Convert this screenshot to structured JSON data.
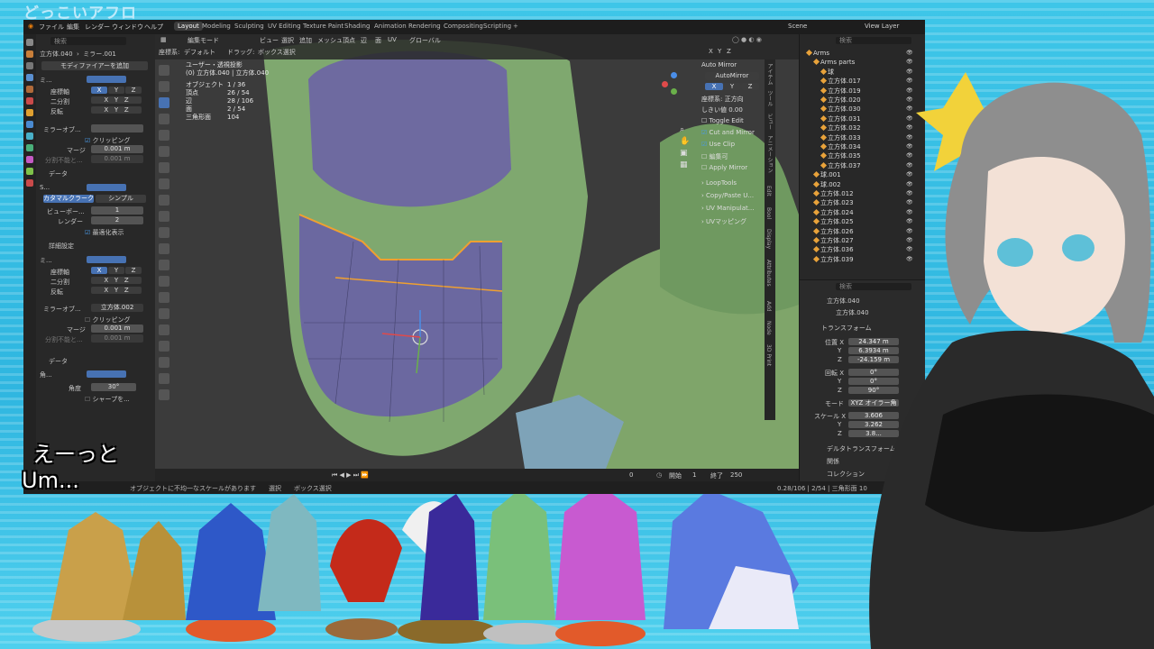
{
  "channel_logo": "どっこいアフロ",
  "topbar": {
    "menus": [
      "ファイル",
      "編集",
      "レンダー",
      "ウィンドウ",
      "ヘルプ"
    ],
    "workspaces": [
      "Layout",
      "Modeling",
      "Sculpting",
      "UV Editing",
      "Texture Paint",
      "Shading",
      "Animation",
      "Rendering",
      "Compositing",
      "Scripting"
    ],
    "active_workspace": "Layout",
    "scene_label": "Scene",
    "view_layer_label": "View Layer"
  },
  "left_panel": {
    "object_name": "立方体.040",
    "modifier_name": "ミラー.001",
    "add_modifier": "モディファイアーを追加",
    "mirror1": {
      "name": "ミ...",
      "axis_label": "座標軸",
      "bisect_label": "二分割",
      "flip_label": "反転",
      "x": "X",
      "y": "Y",
      "z": "Z",
      "mirror_obj_label": "ミラーオブ...",
      "clipping": "クリッピング",
      "merge_label": "マージ",
      "merge_value": "0.001 m",
      "bisect_dist_label": "分割不能と...",
      "bisect_dist_value": "0.001 m",
      "data_label": "データ"
    },
    "subsurf": {
      "name": "S...",
      "catmull": "カタマルクラーク",
      "simple": "シンプル",
      "viewport_label": "ビューポー...",
      "viewport_value": "1",
      "render_label": "レンダー",
      "render_value": "2",
      "optimal": "最適化表示",
      "advanced": "詳細設定"
    },
    "mirror2": {
      "name": "ミ...",
      "axis_label": "座標軸",
      "bisect_label": "二分割",
      "flip_label": "反転",
      "x": "X",
      "y": "Y",
      "z": "Z",
      "mirror_obj_label": "ミラーオブ...",
      "mirror_obj_value": "立方体.002",
      "clipping": "クリッピング",
      "merge_label": "マージ",
      "merge_value": "0.001 m",
      "bisect_dist_label": "分割不能と...",
      "bisect_dist_value": "0.001 m",
      "data_label": "データ"
    },
    "bevel": {
      "name": "角...",
      "angle_label": "角度",
      "angle_value": "30°",
      "sharp_label": "シャープを..."
    }
  },
  "viewport": {
    "mode": "編集モード",
    "menus": [
      "ビュー",
      "選択",
      "追加",
      "メッシュ",
      "頂点",
      "辺",
      "面",
      "UV"
    ],
    "transform_orientation": "グローバル",
    "coord_label": "座標系:",
    "coord_value": "デフォルト",
    "drag_label": "ドラッグ:",
    "drag_value": "ボックス選択",
    "view_title": "ユーザー・透視投影",
    "view_subtitle": "(0) 立方体.040 | 立方体.040",
    "stats": [
      {
        "label": "オブジェクト",
        "value": "1 / 36"
      },
      {
        "label": "頂点",
        "value": "26 / 54"
      },
      {
        "label": "辺",
        "value": "28 / 106"
      },
      {
        "label": "面",
        "value": "2 / 54"
      },
      {
        "label": "三角形面",
        "value": "104"
      }
    ],
    "axis_x": "X",
    "axis_y": "Y",
    "axis_z": "Z",
    "npanel": {
      "auto_mirror_header": "Auto Mirror",
      "auto_mirror_btn": "AutoMirror",
      "x": "X",
      "y": "Y",
      "z": "Z",
      "axis_label": "座標系:",
      "axis_value": "正方向",
      "threshold_label": "しきい値",
      "threshold_value": "0.00",
      "toggle_edit": "Toggle Edit",
      "cut_mirror": "Cut and Mirror",
      "use_clip": "Use Clip",
      "edit_label": "編集可",
      "apply_mirror": "Apply Mirror",
      "looptools": "LoopTools",
      "copy_paste": "Copy/Paste U...",
      "uv_manip": "UV Manipulat...",
      "uv_mapping": "UVマッピング"
    },
    "side_tabs": [
      "アイテム",
      "ツール",
      "ビュー",
      "アニメーション",
      "Edit",
      "Bool",
      "Display",
      "Attributes",
      "Add",
      "Node",
      "3D Print"
    ]
  },
  "timeline": {
    "playback": "再生",
    "keying": "キーイング",
    "view": "ビュー",
    "marker": "マーカー",
    "frame_current": "0",
    "start_label": "開始",
    "start_value": "1",
    "end_label": "終了",
    "end_value": "250"
  },
  "outliner": {
    "search_placeholder": "検索",
    "rows": [
      {
        "name": "Arms",
        "indent": 0
      },
      {
        "name": "Arms parts",
        "indent": 1
      },
      {
        "name": "球",
        "indent": 2
      },
      {
        "name": "立方体.017",
        "indent": 2
      },
      {
        "name": "立方体.019",
        "indent": 2
      },
      {
        "name": "立方体.020",
        "indent": 2
      },
      {
        "name": "立方体.030",
        "indent": 2
      },
      {
        "name": "立方体.031",
        "indent": 2
      },
      {
        "name": "立方体.032",
        "indent": 2
      },
      {
        "name": "立方体.033",
        "indent": 2
      },
      {
        "name": "立方体.034",
        "indent": 2
      },
      {
        "name": "立方体.035",
        "indent": 2
      },
      {
        "name": "立方体.037",
        "indent": 2
      },
      {
        "name": "球.001",
        "indent": 1
      },
      {
        "name": "球.002",
        "indent": 1
      },
      {
        "name": "立方体.012",
        "indent": 1
      },
      {
        "name": "立方体.023",
        "indent": 1
      },
      {
        "name": "立方体.024",
        "indent": 1
      },
      {
        "name": "立方体.025",
        "indent": 1
      },
      {
        "name": "立方体.026",
        "indent": 1
      },
      {
        "name": "立方体.027",
        "indent": 1
      },
      {
        "name": "立方体.036",
        "indent": 1
      },
      {
        "name": "立方体.039",
        "indent": 1
      }
    ]
  },
  "properties": {
    "search_placeholder": "検索",
    "object_name": "立方体.040",
    "object_name2": "立方体.040",
    "transform_header": "トランスフォーム",
    "location_label": "位置 X",
    "loc_x": "24.347 m",
    "loc_y": "6.3934 m",
    "loc_z": "-24.159 m",
    "rotation_label": "回転 X",
    "rot_x": "0°",
    "rot_y": "0°",
    "rot_z": "90°",
    "mode_label": "モード",
    "mode_value": "XYZ オイラー角",
    "scale_label": "スケール X",
    "scale_x": "3.606",
    "scale_y": "3.262",
    "scale_z": "3.8...",
    "delta_header": "デルタトランスフォーム",
    "relations_header": "関係",
    "collection_header": "コレクション",
    "y_label": "Y",
    "z_label": "Z"
  },
  "statusbar": {
    "message": "オブジェクトに不均一なスケールがあります",
    "select_label": "選択",
    "box_label": "ボックス選択",
    "stats": "0.28/106 | 2/54 | 三角形面 10"
  },
  "subtitles": {
    "japanese": "えーっと",
    "english": "Um..."
  }
}
